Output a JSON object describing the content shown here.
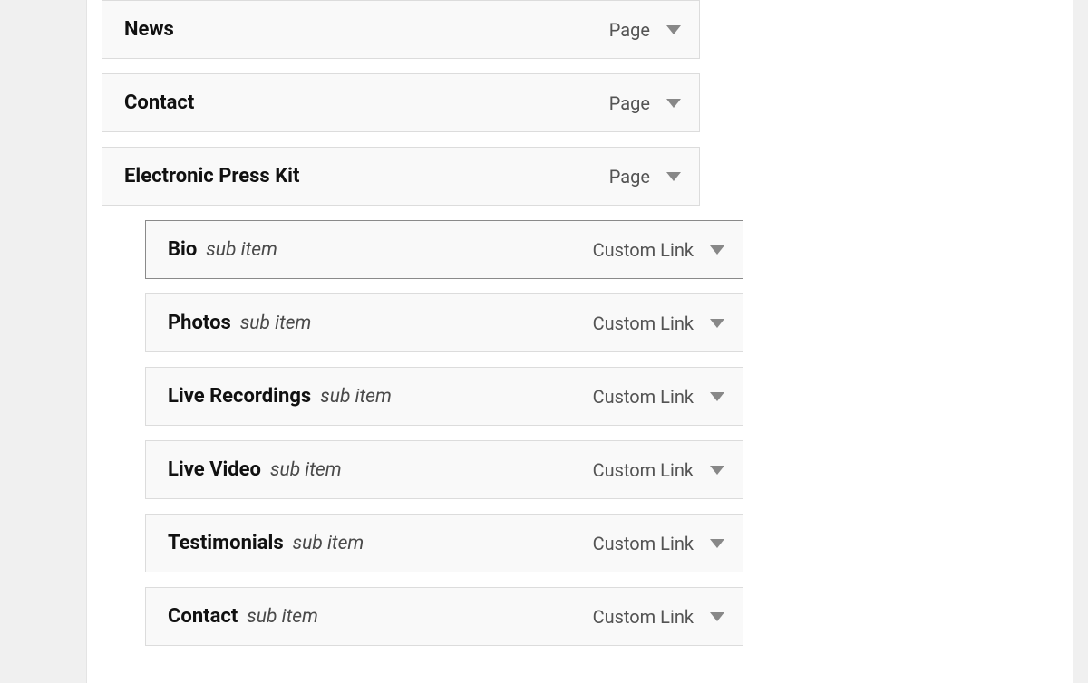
{
  "subItemLabel": "sub item",
  "menuItems": [
    {
      "title": "News",
      "type": "Page",
      "level": "top",
      "selected": false
    },
    {
      "title": "Contact",
      "type": "Page",
      "level": "top",
      "selected": false
    },
    {
      "title": "Electronic Press Kit",
      "type": "Page",
      "level": "top",
      "selected": false
    },
    {
      "title": "Bio",
      "type": "Custom Link",
      "level": "sub",
      "selected": true
    },
    {
      "title": "Photos",
      "type": "Custom Link",
      "level": "sub",
      "selected": false
    },
    {
      "title": "Live Recordings",
      "type": "Custom Link",
      "level": "sub",
      "selected": false
    },
    {
      "title": "Live Video",
      "type": "Custom Link",
      "level": "sub",
      "selected": false
    },
    {
      "title": "Testimonials",
      "type": "Custom Link",
      "level": "sub",
      "selected": false
    },
    {
      "title": "Contact",
      "type": "Custom Link",
      "level": "sub",
      "selected": false
    }
  ]
}
